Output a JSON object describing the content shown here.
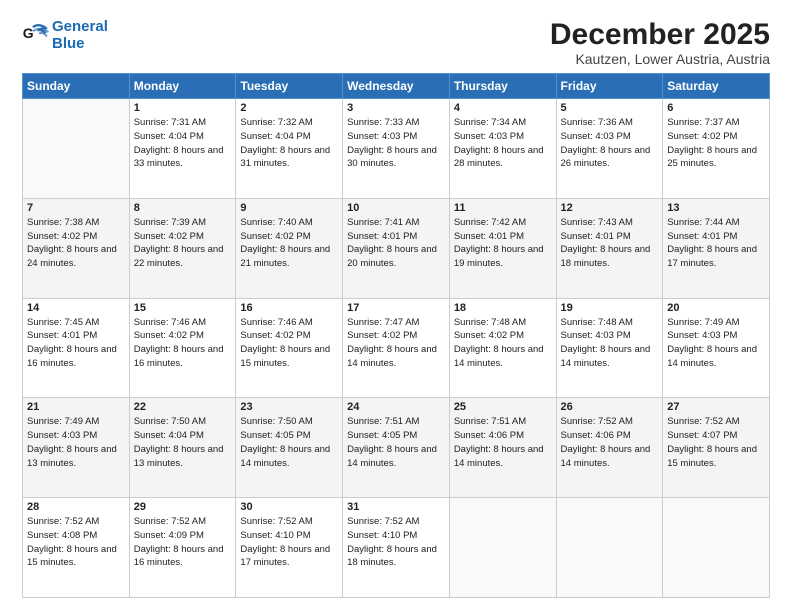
{
  "logo": {
    "line1": "General",
    "line2": "Blue"
  },
  "title": "December 2025",
  "location": "Kautzen, Lower Austria, Austria",
  "weekdays": [
    "Sunday",
    "Monday",
    "Tuesday",
    "Wednesday",
    "Thursday",
    "Friday",
    "Saturday"
  ],
  "weeks": [
    [
      {
        "day": null
      },
      {
        "day": 1,
        "rise": "7:31 AM",
        "set": "4:04 PM",
        "hours": "8 hours and 33 minutes."
      },
      {
        "day": 2,
        "rise": "7:32 AM",
        "set": "4:04 PM",
        "hours": "8 hours and 31 minutes."
      },
      {
        "day": 3,
        "rise": "7:33 AM",
        "set": "4:03 PM",
        "hours": "8 hours and 30 minutes."
      },
      {
        "day": 4,
        "rise": "7:34 AM",
        "set": "4:03 PM",
        "hours": "8 hours and 28 minutes."
      },
      {
        "day": 5,
        "rise": "7:36 AM",
        "set": "4:03 PM",
        "hours": "8 hours and 26 minutes."
      },
      {
        "day": 6,
        "rise": "7:37 AM",
        "set": "4:02 PM",
        "hours": "8 hours and 25 minutes."
      }
    ],
    [
      {
        "day": 7,
        "rise": "7:38 AM",
        "set": "4:02 PM",
        "hours": "8 hours and 24 minutes."
      },
      {
        "day": 8,
        "rise": "7:39 AM",
        "set": "4:02 PM",
        "hours": "8 hours and 22 minutes."
      },
      {
        "day": 9,
        "rise": "7:40 AM",
        "set": "4:02 PM",
        "hours": "8 hours and 21 minutes."
      },
      {
        "day": 10,
        "rise": "7:41 AM",
        "set": "4:01 PM",
        "hours": "8 hours and 20 minutes."
      },
      {
        "day": 11,
        "rise": "7:42 AM",
        "set": "4:01 PM",
        "hours": "8 hours and 19 minutes."
      },
      {
        "day": 12,
        "rise": "7:43 AM",
        "set": "4:01 PM",
        "hours": "8 hours and 18 minutes."
      },
      {
        "day": 13,
        "rise": "7:44 AM",
        "set": "4:01 PM",
        "hours": "8 hours and 17 minutes."
      }
    ],
    [
      {
        "day": 14,
        "rise": "7:45 AM",
        "set": "4:01 PM",
        "hours": "8 hours and 16 minutes."
      },
      {
        "day": 15,
        "rise": "7:46 AM",
        "set": "4:02 PM",
        "hours": "8 hours and 16 minutes."
      },
      {
        "day": 16,
        "rise": "7:46 AM",
        "set": "4:02 PM",
        "hours": "8 hours and 15 minutes."
      },
      {
        "day": 17,
        "rise": "7:47 AM",
        "set": "4:02 PM",
        "hours": "8 hours and 14 minutes."
      },
      {
        "day": 18,
        "rise": "7:48 AM",
        "set": "4:02 PM",
        "hours": "8 hours and 14 minutes."
      },
      {
        "day": 19,
        "rise": "7:48 AM",
        "set": "4:03 PM",
        "hours": "8 hours and 14 minutes."
      },
      {
        "day": 20,
        "rise": "7:49 AM",
        "set": "4:03 PM",
        "hours": "8 hours and 14 minutes."
      }
    ],
    [
      {
        "day": 21,
        "rise": "7:49 AM",
        "set": "4:03 PM",
        "hours": "8 hours and 13 minutes."
      },
      {
        "day": 22,
        "rise": "7:50 AM",
        "set": "4:04 PM",
        "hours": "8 hours and 13 minutes."
      },
      {
        "day": 23,
        "rise": "7:50 AM",
        "set": "4:05 PM",
        "hours": "8 hours and 14 minutes."
      },
      {
        "day": 24,
        "rise": "7:51 AM",
        "set": "4:05 PM",
        "hours": "8 hours and 14 minutes."
      },
      {
        "day": 25,
        "rise": "7:51 AM",
        "set": "4:06 PM",
        "hours": "8 hours and 14 minutes."
      },
      {
        "day": 26,
        "rise": "7:52 AM",
        "set": "4:06 PM",
        "hours": "8 hours and 14 minutes."
      },
      {
        "day": 27,
        "rise": "7:52 AM",
        "set": "4:07 PM",
        "hours": "8 hours and 15 minutes."
      }
    ],
    [
      {
        "day": 28,
        "rise": "7:52 AM",
        "set": "4:08 PM",
        "hours": "8 hours and 15 minutes."
      },
      {
        "day": 29,
        "rise": "7:52 AM",
        "set": "4:09 PM",
        "hours": "8 hours and 16 minutes."
      },
      {
        "day": 30,
        "rise": "7:52 AM",
        "set": "4:10 PM",
        "hours": "8 hours and 17 minutes."
      },
      {
        "day": 31,
        "rise": "7:52 AM",
        "set": "4:10 PM",
        "hours": "8 hours and 18 minutes."
      },
      null,
      null,
      null
    ]
  ],
  "labels": {
    "sunrise": "Sunrise:",
    "sunset": "Sunset:",
    "daylight": "Daylight:"
  }
}
